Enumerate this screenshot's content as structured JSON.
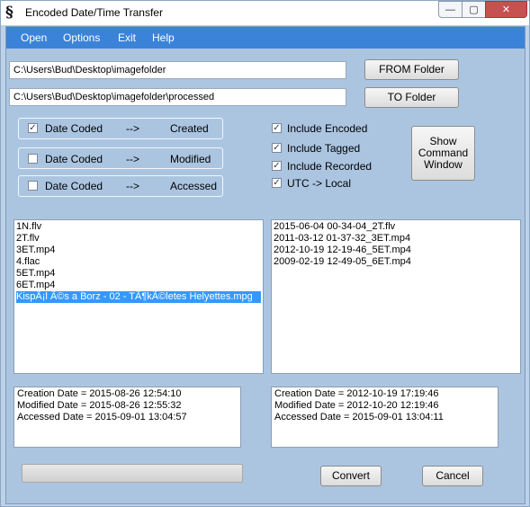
{
  "window": {
    "title": "Encoded Date/Time Transfer",
    "app_icon_glyph": "§",
    "controls": {
      "minimize": "—",
      "maximize": "▢",
      "close": "✕"
    }
  },
  "menu": [
    "Open",
    "Options",
    "Exit",
    "Help"
  ],
  "folders": {
    "from_path": "C:\\Users\\Bud\\Desktop\\imagefolder",
    "to_path": "C:\\Users\\Bud\\Desktop\\imagefolder\\processed",
    "from_button": "FROM Folder",
    "to_button": "TO Folder"
  },
  "mappings": [
    {
      "checked": true,
      "source": "Date Coded",
      "arrow": "-->",
      "target": "Created"
    },
    {
      "checked": false,
      "source": "Date Coded",
      "arrow": "-->",
      "target": "Modified"
    },
    {
      "checked": false,
      "source": "Date Coded",
      "arrow": "-->",
      "target": "Accessed"
    }
  ],
  "options": [
    {
      "label": "Include Encoded",
      "checked": true
    },
    {
      "label": "Include Tagged",
      "checked": true
    },
    {
      "label": "Include Recorded",
      "checked": true
    },
    {
      "label": "UTC -> Local",
      "checked": true
    }
  ],
  "show_command_button": [
    "Show",
    "Command",
    "Window"
  ],
  "source_files": [
    "1N.flv",
    "2T.flv",
    "3ET.mp4",
    "4.flac",
    "5ET.mp4",
    "6ET.mp4",
    "KispÃ¡l Ã©s a Borz - 02 - TÃ¶kÃ©letes Helyettes.mpg"
  ],
  "selected_index": 6,
  "output_files": [
    "2015-06-04 00-34-04_2T.flv",
    "2011-03-12 01-37-32_3ET.mp4",
    "2012-10-19 12-19-46_5ET.mp4",
    "2009-02-19 12-49-05_6ET.mp4"
  ],
  "source_info": {
    "creation": "Creation Date = 2015-08-26 12:54:10",
    "modified": "Modified Date = 2015-08-26 12:55:32",
    "accessed": "Accessed Date = 2015-09-01 13:04:57"
  },
  "output_info": {
    "creation": "Creation Date = 2012-10-19 17:19:46",
    "modified": "Modified Date = 2012-10-20 12:19:46",
    "accessed": "Accessed Date = 2015-09-01 13:04:11"
  },
  "progress": 0,
  "buttons": {
    "convert": "Convert",
    "cancel": "Cancel"
  },
  "check_glyph": "✓"
}
